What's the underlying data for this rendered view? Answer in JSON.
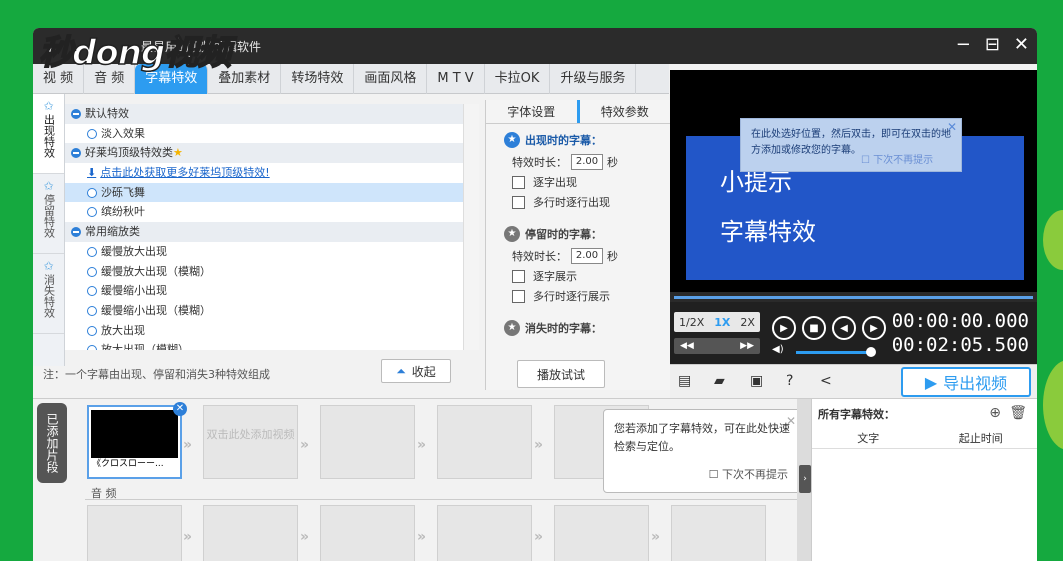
{
  "window": {
    "title": "最易用的视频剪辑软件",
    "logo": "秒dong视频",
    "minimize": "−",
    "restore": "⊟",
    "close": "✕"
  },
  "tabs": [
    "视 频",
    "音 频",
    "字幕特效",
    "叠加素材",
    "转场特效",
    "画面风格",
    "M T V",
    "卡拉OK",
    "升级与服务"
  ],
  "vertical_tabs": [
    {
      "label": "出现特效",
      "icon": "star-in-icon"
    },
    {
      "label": "停留特效",
      "icon": "star-stay-icon"
    },
    {
      "label": "消失特效",
      "icon": "star-out-icon"
    }
  ],
  "effects_list": [
    {
      "type": "category",
      "text": "默认特效"
    },
    {
      "type": "item",
      "text": "淡入效果"
    },
    {
      "type": "category",
      "text": "好莱坞顶级特效类",
      "star": "★"
    },
    {
      "type": "link",
      "text": "点击此处获取更多好莱坞顶级特效!"
    },
    {
      "type": "item",
      "text": "沙砾飞舞",
      "selected": true
    },
    {
      "type": "item",
      "text": "缤纷秋叶"
    },
    {
      "type": "category",
      "text": "常用缩放类"
    },
    {
      "type": "item",
      "text": "缓慢放大出现"
    },
    {
      "type": "item",
      "text": "缓慢放大出现（模糊）"
    },
    {
      "type": "item",
      "text": "缓慢缩小出现"
    },
    {
      "type": "item",
      "text": "缓慢缩小出现（模糊）"
    },
    {
      "type": "item",
      "text": "放大出现"
    },
    {
      "type": "item",
      "text": "放大出现（模糊）"
    }
  ],
  "footer_note": "注：一个字幕由出现、停留和消失3种特效组成",
  "collapse_button": "收起",
  "params": {
    "tabs": [
      "字体设置",
      "特效参数"
    ],
    "appear": {
      "title": "出现时的字幕：",
      "duration_label": "特效时长：",
      "duration": "2.00",
      "unit": "秒",
      "options": [
        "逐字出现",
        "多行时逐行出现"
      ]
    },
    "stay": {
      "title": "停留时的字幕：",
      "duration_label": "特效时长：",
      "duration": "2.00",
      "unit": "秒",
      "options": [
        "逐字展示",
        "多行时逐行展示"
      ]
    },
    "disappear": {
      "title": "消失时的字幕："
    },
    "trial_button": "播放试试"
  },
  "preview": {
    "line1": "小提示",
    "line2": "字幕特效",
    "tip": "在此处选好位置，然后双击，即可在双击的地方添加或修改您的字幕。",
    "tip_checkbox": "下次不再提示"
  },
  "player": {
    "speeds": [
      "1/2X",
      "1X",
      "2X"
    ],
    "active_speed": "1X",
    "current_time": "00:00:00.000",
    "total_time": "00:02:05.500",
    "volume_level": 0.9
  },
  "export_button": "导出视频",
  "timeline": {
    "label": "已添加片段",
    "first_clip_caption": "《クロスローー...",
    "placeholder": "双击此处添加视频",
    "audio_label": "音 频",
    "bubble_text": "您若添加了字幕特效，可在此处快速检索与定位。",
    "bubble_checkbox": "下次不再提示"
  },
  "subtitles_panel": {
    "title": "所有字幕特效：",
    "columns": [
      "文字",
      "起止时间"
    ]
  },
  "colors": {
    "accent": "#2d9cf0",
    "background": "#15a93f",
    "preview_blue": "#2256c8"
  }
}
